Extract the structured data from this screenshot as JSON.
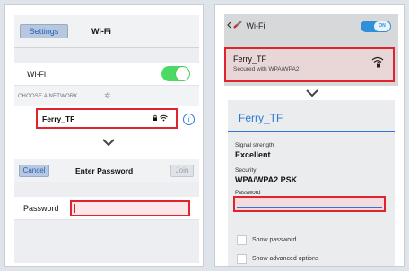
{
  "ios": {
    "back_label": "Settings",
    "title": "Wi-Fi",
    "wifi_label": "Wi-Fi",
    "wifi_on": true,
    "choose_label": "CHOOSE A NETWORK...",
    "spinner_glyph": "✲",
    "network_name": "Ferry_TF",
    "network_icons": "🔒 ᯤ",
    "info_glyph": "i",
    "password_dialog": {
      "cancel_label": "Cancel",
      "title": "Enter Password",
      "join_label": "Join",
      "password_label": "Password",
      "password_value": ""
    }
  },
  "android": {
    "title": "Wi-Fi",
    "toggle_label": "ON",
    "network_name": "Ferry_TF",
    "network_security": "Secured with WPA/WPA2",
    "dialog": {
      "title": "Ferry_TF",
      "signal_label": "Signal strength",
      "signal_value": "Excellent",
      "security_label": "Security",
      "security_value": "WPA/WPA2 PSK",
      "password_label": "Password",
      "password_value": "",
      "show_password_label": "Show password",
      "show_advanced_label": "Show advanced options"
    }
  },
  "colors": {
    "highlight": "#e0232d",
    "ios_toggle": "#4cd964",
    "android_accent": "#2b78d2"
  }
}
